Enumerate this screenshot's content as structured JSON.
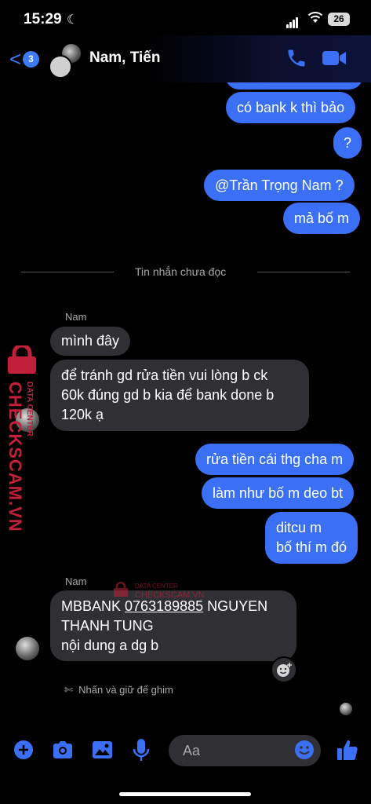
{
  "status_bar": {
    "time": "15:29",
    "battery": "26"
  },
  "header": {
    "unread_count": "3",
    "title": "Nam, Tiến"
  },
  "messages_top": [
    {
      "text": "có bank k thì bảo"
    },
    {
      "text": "?"
    },
    {
      "text": "@Trần Trọng Nam ?"
    },
    {
      "text": "mả bố m"
    }
  ],
  "divider": {
    "text": "Tin nhắn chưa đọc"
  },
  "group1": {
    "sender": "Nam",
    "msgs": [
      "mình đây",
      "để tránh gd rửa tiền vui lòng b ck",
      "60k đúng gd b kia để bank done b",
      "120k ạ"
    ]
  },
  "outgoing": [
    {
      "text": "rửa tiền cái thg cha m"
    },
    {
      "text": "làm như bố m deo bt"
    },
    {
      "line1": "ditcu m",
      "line2": "bố thí m đó"
    }
  ],
  "group2": {
    "sender": "Nam",
    "bank": "MBBANK ",
    "account": "0763189885",
    "name1": " NGUYEN",
    "name2": "THANH TUNG",
    "content": "nội dung a dg b"
  },
  "pin_hint": "Nhấn và giữ để ghim",
  "composer": {
    "placeholder": "Aa"
  },
  "watermark": {
    "top": "DATA CENTER",
    "main": "CHECKSCAM.VN"
  },
  "colors": {
    "accent": "#3b70f6",
    "incoming": "#303034",
    "watermark": "#c2203a"
  }
}
